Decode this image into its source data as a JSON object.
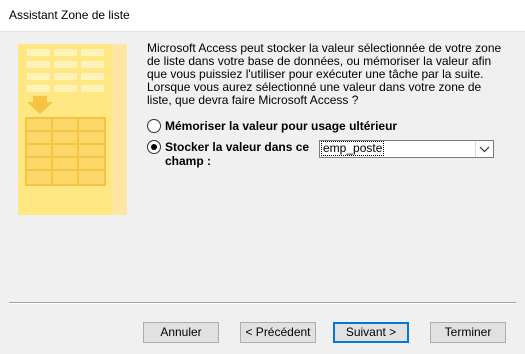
{
  "window": {
    "title": "Assistant Zone de liste"
  },
  "description": "Microsoft Access peut stocker la valeur sélectionnée de votre zone de liste dans votre base de données, ou mémoriser la valeur afin que vous puissiez l'utiliser pour exécuter une tâche par la suite. Lorsque vous aurez sélectionné une valeur dans votre zone de liste, que devra faire Microsoft Access ?",
  "options": {
    "remember": {
      "label": "Mémoriser la valeur pour usage ultérieur",
      "selected": false
    },
    "store": {
      "label_line1": "Stocker la valeur dans ce",
      "label_line2": "champ :",
      "selected": true,
      "field_value": "emp_poste"
    }
  },
  "buttons": {
    "cancel": "Annuler",
    "previous": "< Précédent",
    "next": "Suivant >",
    "finish": "Terminer"
  },
  "colors": {
    "illustration_bg": "#ffe784",
    "illustration_dark": "#f6c443",
    "focus_border": "#0078d7"
  },
  "icons": {
    "combo_arrow": "chevron-down-icon"
  }
}
